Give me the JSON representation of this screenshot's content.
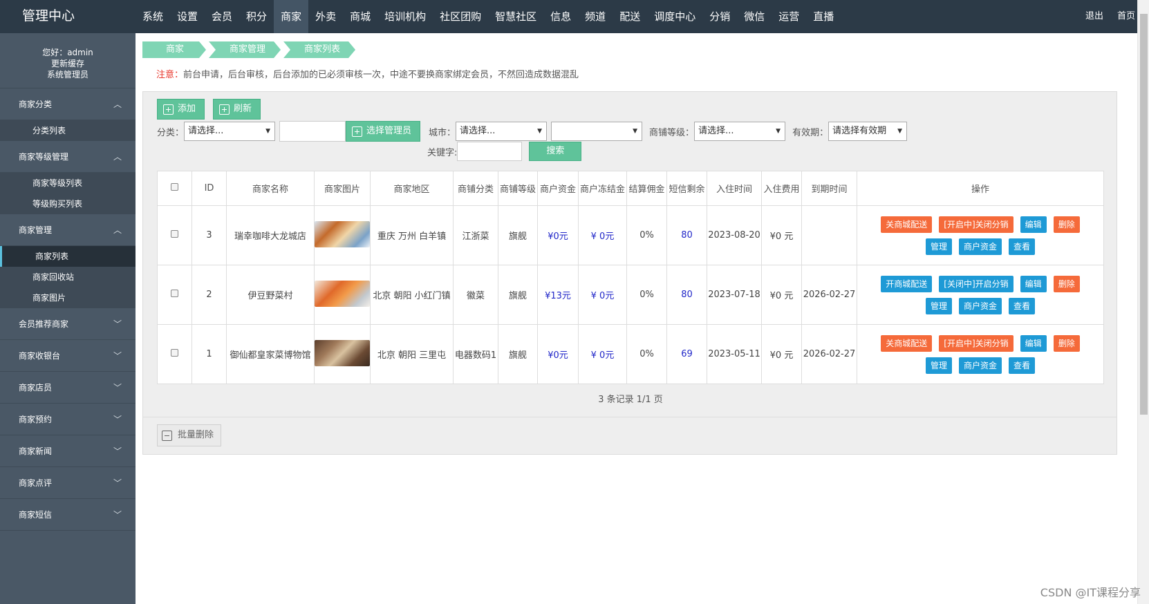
{
  "brand": "管理中心",
  "topnav": [
    "系统",
    "设置",
    "会员",
    "积分",
    "商家",
    "外卖",
    "商城",
    "培训机构",
    "社区团购",
    "智慧社区",
    "信息",
    "频道",
    "配送",
    "调度中心",
    "分销",
    "微信",
    "运营",
    "直播"
  ],
  "topnav_active": "商家",
  "topright": {
    "logout": "退出",
    "home": "首页"
  },
  "user": {
    "greeting": "您好：admin",
    "refresh": "更新缓存",
    "role": "系统管理员"
  },
  "sidebar": {
    "cat": {
      "label": "商家分类",
      "items": [
        "分类列表"
      ]
    },
    "level": {
      "label": "商家等级管理",
      "items": [
        "商家等级列表",
        "等级购买列表"
      ]
    },
    "manage": {
      "label": "商家管理",
      "items": [
        "商家列表",
        "商家回收站",
        "商家图片"
      ]
    },
    "collapsed": [
      "会员推荐商家",
      "商家收银台",
      "商家店员",
      "商家预约",
      "商家新闻",
      "商家点评",
      "商家短信"
    ]
  },
  "breadcrumb": [
    "商家",
    "商家管理",
    "商家列表"
  ],
  "notice": {
    "label": "注意：",
    "text": "前台申请，后台审核，后台添加的已必须审核一次，中途不要换商家绑定会员，不然回造成数据混乱"
  },
  "toolbar": {
    "add": "添加",
    "refresh": "刷新"
  },
  "filters": {
    "category_label": "分类：",
    "category_value": "请选择...",
    "choose_admin": "选择管理员",
    "city_label": "城市：",
    "city_value": "请选择...",
    "district_value": "",
    "level_label": "商铺等级：",
    "level_value": "请选择...",
    "valid_label": "有效期：",
    "valid_value": "请选择有效期",
    "keyword_label": "关键字:",
    "search": "搜索"
  },
  "table": {
    "headers": [
      "",
      "ID",
      "商家名称",
      "商家图片",
      "商家地区",
      "商铺分类",
      "商铺等级",
      "商户资金",
      "商户冻结金",
      "结算佣金",
      "短信剩余",
      "入住时间",
      "入住费用",
      "到期时间",
      "操作"
    ],
    "rows": [
      {
        "id": "3",
        "name": "瑞幸咖啡大龙城店",
        "region": "重庆 万州 白羊镇",
        "category": "江浙菜",
        "level": "旗舰",
        "funds": "¥0元",
        "frozen": "¥ 0元",
        "commission": "0%",
        "sms": "80",
        "joined": "2023-08-20",
        "fee": "¥0 元",
        "expires": "",
        "op1": "关商城配送",
        "op2": "[开启中]关闭分销",
        "op1_color": "#f56a3a",
        "op2_color": "#f56a3a"
      },
      {
        "id": "2",
        "name": "伊豆野菜村",
        "region": "北京 朝阳 小红门镇",
        "category": "徽菜",
        "level": "旗舰",
        "funds": "¥13元",
        "frozen": "¥ 0元",
        "commission": "0%",
        "sms": "80",
        "joined": "2023-07-18",
        "fee": "¥0 元",
        "expires": "2026-02-27",
        "op1": "开商城配送",
        "op2": "[关闭中]开启分销",
        "op1_color": "#1e9ad6",
        "op2_color": "#1e9ad6"
      },
      {
        "id": "1",
        "name": "御仙都皇家菜博物馆",
        "region": "北京 朝阳 三里屯",
        "category": "电器数码1",
        "level": "旗舰",
        "funds": "¥0元",
        "frozen": "¥ 0元",
        "commission": "0%",
        "sms": "69",
        "joined": "2023-05-11",
        "fee": "¥0 元",
        "expires": "2026-02-27",
        "op1": "关商城配送",
        "op2": "[开启中]关闭分销",
        "op1_color": "#f56a3a",
        "op2_color": "#f56a3a"
      }
    ],
    "ops": {
      "edit": "编辑",
      "delete": "删除",
      "manage": "管理",
      "funds": "商户资金",
      "view": "查看"
    }
  },
  "pager": "3 条记录 1/1 页",
  "batch_delete": "批量删除",
  "watermark": "CSDN @IT课程分享"
}
